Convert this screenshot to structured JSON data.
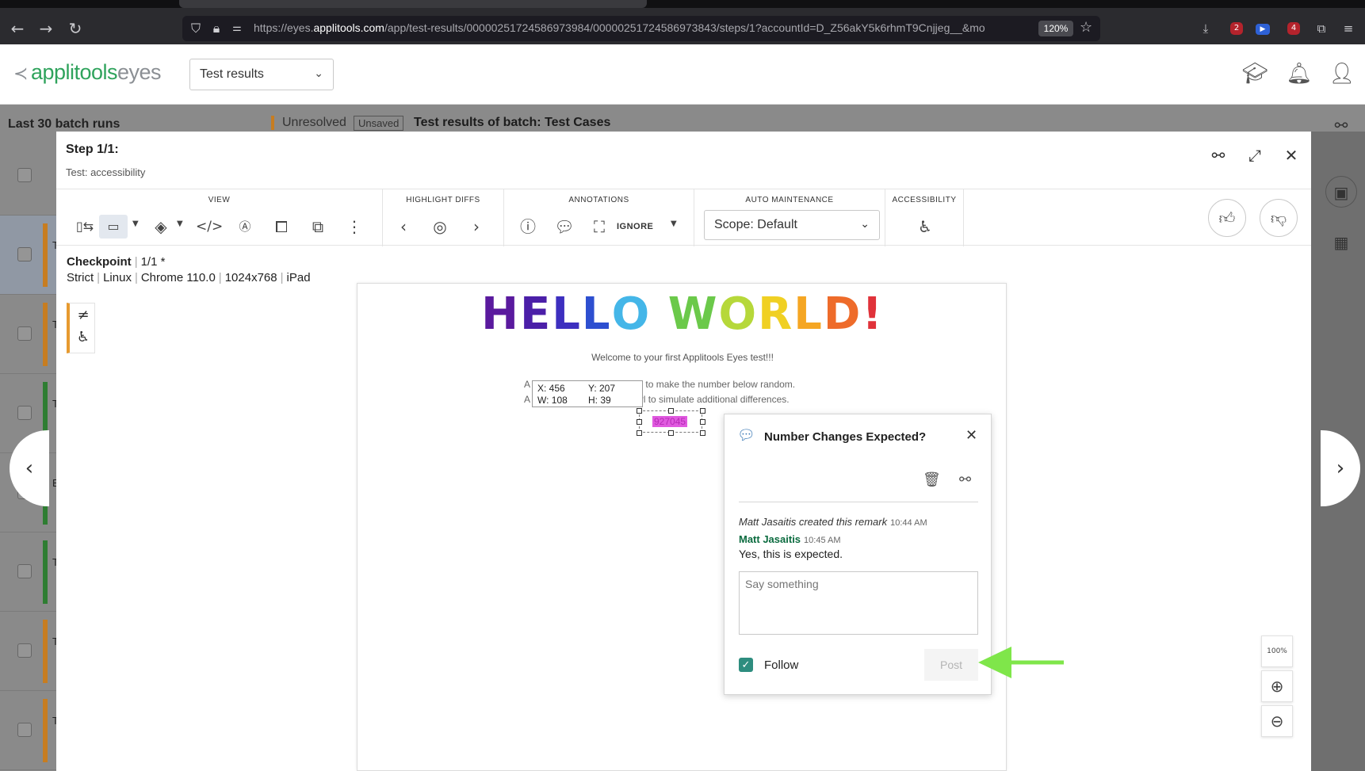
{
  "browser": {
    "url_prefix": "https://eyes.",
    "url_domain": "applitools.com",
    "url_rest": "/app/test-results/00000251724586973984/00000251724586973843/steps/1?accountId=D_Z56akY5k6rhmT9Cnjjeg__&mo",
    "zoom": "120%",
    "badge_2": "2",
    "badge_4": "4"
  },
  "header": {
    "logo_main": "applitools",
    "logo_sub": "eyes",
    "view_select": "Test results"
  },
  "sidebar": {
    "title": "Last 30 batch runs",
    "rows": [
      {
        "initial": "T",
        "bar_color": "#c77d21"
      },
      {
        "initial": "T",
        "bar_color": "#c77d21"
      },
      {
        "initial": "T",
        "bar_color": "#2e7d32"
      },
      {
        "initial": "E",
        "bar_color": "#2e7d32"
      },
      {
        "initial": "T",
        "bar_color": "#2e7d32"
      },
      {
        "initial": "T",
        "bar_color": "#c77d21"
      },
      {
        "initial": "T",
        "bar_color": "#c77d21"
      }
    ]
  },
  "batch": {
    "status": "Unresolved",
    "unsaved": "Unsaved",
    "title": "Test results of batch:  Test Cases"
  },
  "modal": {
    "step_title": "Step 1/1:",
    "test_name": "Test: accessibility",
    "toolbar": {
      "view_label": "VIEW",
      "highlight_label": "HIGHLIGHT DIFFS",
      "annotations_label": "ANNOTATIONS",
      "ignore_label": "IGNORE",
      "auto_label": "AUTO MAINTENANCE",
      "scope": "Scope: Default",
      "accessibility_label": "ACCESSIBILITY"
    },
    "checkpoint": {
      "label": "Checkpoint",
      "count": "1/1  *",
      "match_level": "Strict",
      "os": "Linux",
      "browser": "Chrome 110.0",
      "viewport": "1024x768",
      "device": "iPad"
    }
  },
  "screenshot": {
    "hello": [
      "H",
      "E",
      "L",
      "L",
      "O",
      " ",
      "W",
      "O",
      "R",
      "L",
      "D",
      "!"
    ],
    "hello_colors": [
      "#5a1a9e",
      "#4b1fa8",
      "#3d2fbf",
      "#2d4fd0",
      "#44b6e8",
      "#ffffff",
      "#6bc94a",
      "#b6d83a",
      "#f0d023",
      "#f5a623",
      "#ee6b2a",
      "#e0323a"
    ],
    "welcome": "Welcome to your first Applitools Eyes test!!!",
    "line1_prefix": "A",
    "line1": "he url to make the number below random.",
    "line2_prefix": "A",
    "line2": "the url to simulate additional differences.",
    "coords": {
      "x": "X: 456",
      "y": "Y: 207",
      "w": "W: 108",
      "h": "H: 39"
    },
    "number": "927045"
  },
  "remark": {
    "title": "Number Changes Expected?",
    "created_by": "Matt Jasaitis created this remark",
    "created_time": "10:44 AM",
    "author": "Matt Jasaitis",
    "author_time": "10:45 AM",
    "message": "Yes, this is expected.",
    "input_placeholder": "Say something",
    "follow_label": "Follow",
    "post_label": "Post"
  },
  "zoom_controls": {
    "fit_label": "100%"
  },
  "colors": {
    "accent_green": "#2fa35c",
    "arrow_green": "#7fe64a",
    "check_teal": "#2e8d7f",
    "diff_orange": "#e79a2f"
  }
}
